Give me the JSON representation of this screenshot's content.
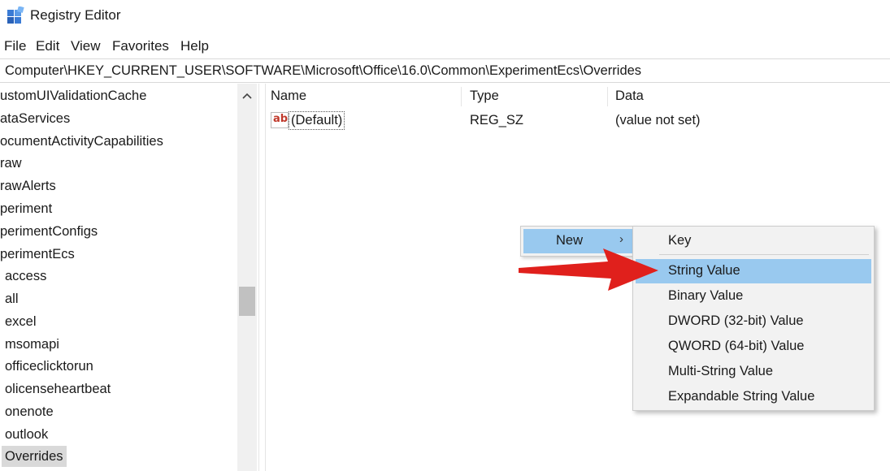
{
  "window": {
    "title": "Registry Editor",
    "icon": "registry-editor-icon"
  },
  "menu": [
    "File",
    "Edit",
    "View",
    "Favorites",
    "Help"
  ],
  "address": "Computer\\HKEY_CURRENT_USER\\SOFTWARE\\Microsoft\\Office\\16.0\\Common\\ExperimentEcs\\Overrides",
  "tree": {
    "items": [
      "ustomUIValidationCache",
      "ataServices",
      "ocumentActivityCapabilities",
      "raw",
      "rawAlerts",
      "periment",
      "perimentConfigs",
      "perimentEcs",
      "access",
      "all",
      "excel",
      "msomapi",
      "officeclicktorun",
      "olicenseheartbeat",
      "onenote",
      "outlook",
      "Overrides"
    ],
    "selected": "Overrides"
  },
  "list": {
    "columns": [
      "Name",
      "Type",
      "Data"
    ],
    "rows": [
      {
        "name": "(Default)",
        "type": "REG_SZ",
        "data": "(value not set)",
        "icon": "string-value-icon"
      }
    ]
  },
  "context_menu": {
    "new_label": "New",
    "submenu": [
      "Key",
      "String Value",
      "Binary Value",
      "DWORD (32-bit) Value",
      "QWORD (64-bit) Value",
      "Multi-String Value",
      "Expandable String Value"
    ],
    "highlighted": "String Value"
  },
  "colors": {
    "highlight": "#99c9ef",
    "arrow": "#e0201c",
    "selected_tree": "#d9d9d9"
  }
}
